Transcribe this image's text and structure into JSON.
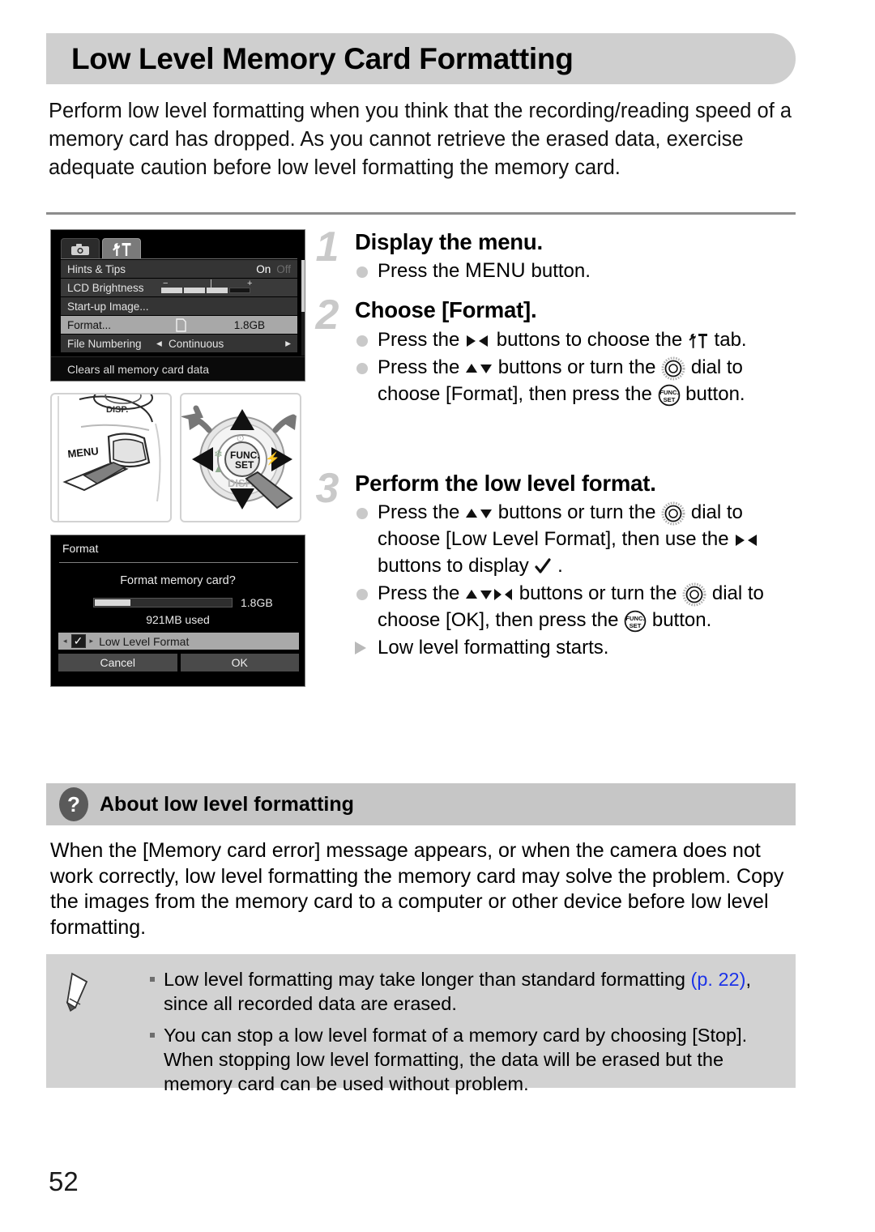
{
  "page": {
    "title": "Low Level Memory Card Formatting",
    "number": "52",
    "intro": "Perform low level formatting when you think that the recording/reading speed of a memory card has dropped. As you cannot retrieve the erased data, exercise adequate caution before low level formatting the memory card."
  },
  "camera_menu": {
    "tabs": [
      {
        "icon": "camera-icon",
        "state": "inactive"
      },
      {
        "icon": "wrench-hammer-icon",
        "state": "active"
      }
    ],
    "rows": [
      {
        "label": "Hints & Tips",
        "value_on": "On",
        "value_off": "Off",
        "type": "toggle",
        "selected": false
      },
      {
        "label": "LCD Brightness",
        "type": "slider",
        "minus": "−",
        "plus": "+",
        "selected": false
      },
      {
        "label": "Start-up Image...",
        "type": "submenu",
        "selected": false
      },
      {
        "label": "Format...",
        "value": "1.8GB",
        "icon": "sd-card-icon",
        "type": "value",
        "selected": true
      },
      {
        "label": "Continuous",
        "row_label": "File Numbering",
        "type": "spinner",
        "left_arrow": "◂",
        "right_arrow": "▸",
        "selected": false
      }
    ],
    "hint": "Clears all memory card data"
  },
  "illustrations": [
    {
      "name": "menu-button-press",
      "labels": [
        "MENU",
        "DISP."
      ]
    },
    {
      "name": "control-dial-press",
      "labels": [
        "FUNC.",
        "SET",
        "DISP."
      ]
    }
  ],
  "format_dialog": {
    "title": "Format",
    "question": "Format memory card?",
    "capacity": "1.8GB",
    "used": "921MB used",
    "low_level_label": "Low Level Format",
    "checkbox": "✓",
    "left_arrow": "◂",
    "right_arrow": "▸",
    "buttons": [
      {
        "label": "Cancel"
      },
      {
        "label": "OK"
      }
    ]
  },
  "steps": [
    {
      "number": "1",
      "heading": "Display the menu.",
      "bullets": [
        {
          "marker": "dot",
          "parts": [
            {
              "t": "text",
              "v": "Press the "
            },
            {
              "t": "menuword",
              "v": "MENU"
            },
            {
              "t": "text",
              "v": " button."
            }
          ]
        }
      ]
    },
    {
      "number": "2",
      "heading": "Choose [Format].",
      "bullets": [
        {
          "marker": "dot",
          "parts": [
            {
              "t": "text",
              "v": "Press the "
            },
            {
              "t": "icon",
              "v": "left-right-arrows-icon"
            },
            {
              "t": "text",
              "v": " buttons to choose the "
            },
            {
              "t": "icon",
              "v": "wrench-hammer-tab-icon"
            },
            {
              "t": "text",
              "v": " tab."
            }
          ]
        },
        {
          "marker": "dot",
          "parts": [
            {
              "t": "text",
              "v": "Press the "
            },
            {
              "t": "icon",
              "v": "up-down-arrows-icon"
            },
            {
              "t": "text",
              "v": " buttons or turn the "
            },
            {
              "t": "icon",
              "v": "control-dial-icon"
            },
            {
              "t": "text",
              "v": " dial to choose [Format], then press the "
            },
            {
              "t": "icon",
              "v": "func-set-icon"
            },
            {
              "t": "text",
              "v": " button."
            }
          ]
        }
      ]
    },
    {
      "number": "3",
      "heading": "Perform the low level format.",
      "bullets": [
        {
          "marker": "dot",
          "parts": [
            {
              "t": "text",
              "v": "Press the "
            },
            {
              "t": "icon",
              "v": "up-down-arrows-icon"
            },
            {
              "t": "text",
              "v": " buttons or turn the "
            },
            {
              "t": "icon",
              "v": "control-dial-icon"
            },
            {
              "t": "text",
              "v": " dial to choose [Low Level Format], then use the "
            },
            {
              "t": "icon",
              "v": "left-right-arrows-icon"
            },
            {
              "t": "text",
              "v": " buttons to display "
            },
            {
              "t": "icon",
              "v": "checkmark-icon"
            },
            {
              "t": "text",
              "v": " ."
            }
          ]
        },
        {
          "marker": "dot",
          "parts": [
            {
              "t": "text",
              "v": "Press the "
            },
            {
              "t": "icon",
              "v": "four-way-arrows-icon"
            },
            {
              "t": "text",
              "v": " buttons or turn the "
            },
            {
              "t": "icon",
              "v": "control-dial-icon"
            },
            {
              "t": "text",
              "v": " dial to choose [OK], then press the "
            },
            {
              "t": "icon",
              "v": "func-set-icon"
            },
            {
              "t": "text",
              "v": " button."
            }
          ]
        },
        {
          "marker": "triangle",
          "parts": [
            {
              "t": "text",
              "v": "Low level formatting starts."
            }
          ]
        }
      ]
    }
  ],
  "about": {
    "icon": "question-mark-icon",
    "title": "About low level formatting",
    "body": "When the [Memory card error] message appears, or when the camera does not work correctly, low level formatting the memory card may solve the problem. Copy the images from the memory card to a computer or other device before low level formatting."
  },
  "note": {
    "icon": "pencil-icon",
    "items": [
      {
        "text_before": "Low level formatting may take longer than standard formatting ",
        "link": "(p. 22)",
        "text_after": ", since all recorded data are erased."
      },
      {
        "text_before": "You can stop a low level format of a memory card by choosing [Stop]. When stopping low level formatting, the data will be erased but the memory card can be used without problem.",
        "link": "",
        "text_after": ""
      }
    ]
  },
  "colors": {
    "title_band": "#cfcfcf",
    "about_band": "#c6c6c6",
    "note_band": "#d2d2d2",
    "step_number": "#c9c9c9",
    "link": "#1c33e8"
  }
}
